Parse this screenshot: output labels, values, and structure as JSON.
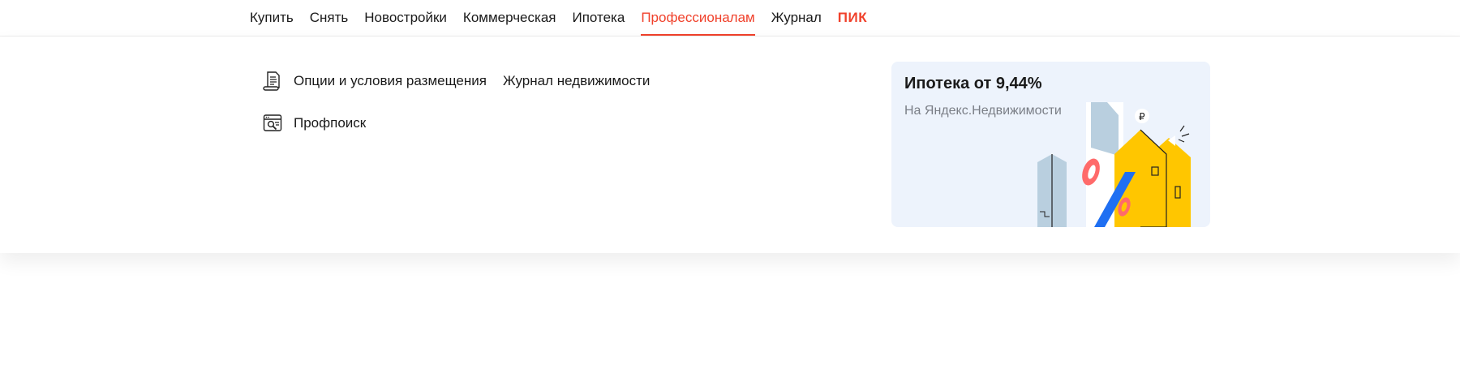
{
  "nav": {
    "items": [
      {
        "label": "Купить",
        "active": false
      },
      {
        "label": "Снять",
        "active": false
      },
      {
        "label": "Новостройки",
        "active": false
      },
      {
        "label": "Коммерческая",
        "active": false
      },
      {
        "label": "Ипотека",
        "active": false
      },
      {
        "label": "Профессионалам",
        "active": true
      },
      {
        "label": "Журнал",
        "active": false
      }
    ],
    "logo": "ПИК",
    "accent_color": "#f0412b"
  },
  "dropdown": {
    "links": {
      "options": {
        "label": "Опции и условия размещения",
        "icon": "document-icon"
      },
      "journal": {
        "label": "Журнал недвижимости"
      },
      "profsearch": {
        "label": "Профпоиск",
        "icon": "browser-search-icon"
      }
    }
  },
  "promo": {
    "title": "Ипотека от 9,44%",
    "subtitle": "На Яндекс.Недвижимости",
    "background_color": "#edf3fc",
    "illustration": "mortgage-houses-illustration"
  }
}
